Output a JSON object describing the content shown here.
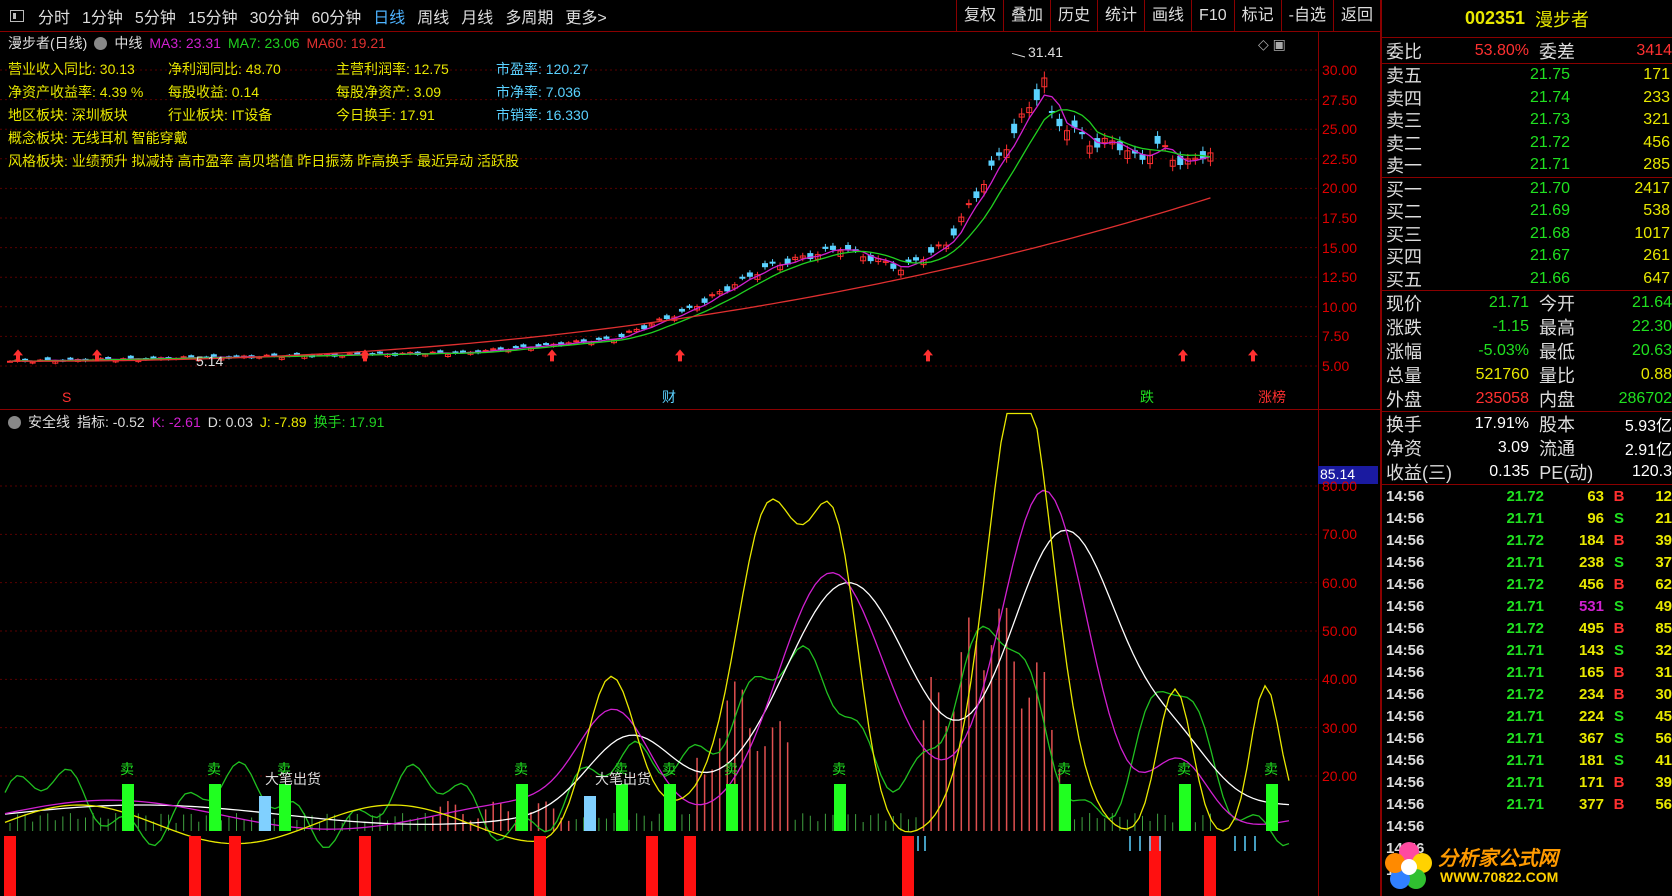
{
  "toolbar": {
    "periods": [
      "分时",
      "1分钟",
      "5分钟",
      "15分钟",
      "30分钟",
      "60分钟",
      "日线",
      "周线",
      "月线",
      "多周期",
      "更多>"
    ],
    "active_period": "日线",
    "tools": [
      "复权",
      "叠加",
      "历史",
      "统计",
      "画线",
      "F10",
      "标记",
      "-自选",
      "返回"
    ]
  },
  "main": {
    "stock_label": "漫步者(日线)",
    "mode": "中线",
    "ma3": "MA3: 23.31",
    "ma7": "MA7: 23.06",
    "ma60": "MA60: 19.21",
    "fund": [
      [
        {
          "k": "营业收入同比:",
          "v": "30.13"
        },
        {
          "k": "净利润同比:",
          "v": "48.70"
        },
        {
          "k": "主营利润率:",
          "v": "12.75"
        },
        {
          "k": "市盈率:",
          "v": "120.27",
          "cyan": true
        }
      ],
      [
        {
          "k": "净资产收益率:",
          "v": "4.39 %"
        },
        {
          "k": "每股收益:",
          "v": "0.14"
        },
        {
          "k": "每股净资产:",
          "v": "3.09"
        },
        {
          "k": "市净率:",
          "v": "7.036"
        }
      ],
      [
        {
          "k": "地区板块:",
          "v": "深圳板块"
        },
        {
          "k": "行业板块:",
          "v": "IT设备"
        },
        {
          "k": "今日换手:",
          "v": "17.91"
        },
        {
          "k": "市销率:",
          "v": "16.330"
        }
      ]
    ],
    "concept": "概念板块: 无线耳机 智能穿戴",
    "style": "风格板块: 业绩预升 拟减持 高市盈率 高贝塔值 昨日振荡 昨高换手 最近异动 活跃股",
    "high_label": "31.41",
    "low_label": "5.14",
    "y_ticks": [
      "30.00",
      "27.50",
      "25.00",
      "22.50",
      "20.00",
      "17.50",
      "15.00",
      "12.50",
      "10.00",
      "7.50",
      "5.00"
    ],
    "events": [
      "S",
      "财",
      "跌",
      "涨榜"
    ]
  },
  "indicator": {
    "name": "安全线",
    "zhibiao": "指标: -0.52",
    "k": "K: -2.61",
    "d": "D: 0.03",
    "j": "J: -7.89",
    "huanshou": "换手: 17.91",
    "cursor_value": "85.14",
    "y_ticks": [
      "80.00",
      "70.00",
      "60.00",
      "50.00",
      "40.00",
      "30.00",
      "20.00"
    ],
    "sell_label": "卖",
    "big_label": "大笔出货"
  },
  "right": {
    "code": "002351",
    "name": "漫步者",
    "weibi_label": "委比",
    "weibi": "53.80%",
    "weicha_label": "委差",
    "weicha": "3414",
    "asks": [
      {
        "l": "卖五",
        "p": "21.75",
        "q": "171"
      },
      {
        "l": "卖四",
        "p": "21.74",
        "q": "233"
      },
      {
        "l": "卖三",
        "p": "21.73",
        "q": "321"
      },
      {
        "l": "卖二",
        "p": "21.72",
        "q": "456"
      },
      {
        "l": "卖一",
        "p": "21.71",
        "q": "285"
      }
    ],
    "bids": [
      {
        "l": "买一",
        "p": "21.70",
        "q": "2417"
      },
      {
        "l": "买二",
        "p": "21.69",
        "q": "538"
      },
      {
        "l": "买三",
        "p": "21.68",
        "q": "1017"
      },
      {
        "l": "买四",
        "p": "21.67",
        "q": "261"
      },
      {
        "l": "买五",
        "p": "21.66",
        "q": "647"
      }
    ],
    "quote": [
      {
        "l1": "现价",
        "v1": "21.71",
        "l2": "今开",
        "v2": "21.64",
        "c2": "#20e020"
      },
      {
        "l1": "涨跌",
        "v1": "-1.15",
        "l2": "最高",
        "v2": "22.30",
        "c2": "#20e020"
      },
      {
        "l1": "涨幅",
        "v1": "-5.03%",
        "l2": "最低",
        "v2": "20.63",
        "c2": "#20e020"
      },
      {
        "l1": "总量",
        "v1": "521760",
        "l2": "量比",
        "v2": "0.88",
        "c1": "#e8e800",
        "c2": "#e8e800"
      },
      {
        "l1": "外盘",
        "v1": "235058",
        "l2": "内盘",
        "v2": "286702",
        "c1": "#ff3030",
        "c2": "#20e020"
      }
    ],
    "stats": [
      {
        "l1": "换手",
        "v1": "17.91%",
        "l2": "股本",
        "v2": "5.93亿"
      },
      {
        "l1": "净资",
        "v1": "3.09",
        "l2": "流通",
        "v2": "2.91亿"
      },
      {
        "l1": "收益(三)",
        "v1": "0.135",
        "l2": "PE(动)",
        "v2": "120.3"
      }
    ],
    "ticks": [
      {
        "t": "14:56",
        "p": "21.72",
        "q": "63",
        "s": "B",
        "n": "12"
      },
      {
        "t": "14:56",
        "p": "21.71",
        "q": "96",
        "s": "S",
        "n": "21"
      },
      {
        "t": "14:56",
        "p": "21.72",
        "q": "184",
        "s": "B",
        "n": "39"
      },
      {
        "t": "14:56",
        "p": "21.71",
        "q": "238",
        "s": "S",
        "n": "37"
      },
      {
        "t": "14:56",
        "p": "21.72",
        "q": "456",
        "s": "B",
        "n": "62"
      },
      {
        "t": "14:56",
        "p": "21.71",
        "q": "531",
        "s": "S",
        "n": "49"
      },
      {
        "t": "14:56",
        "p": "21.72",
        "q": "495",
        "s": "B",
        "n": "85"
      },
      {
        "t": "14:56",
        "p": "21.71",
        "q": "143",
        "s": "S",
        "n": "32"
      },
      {
        "t": "14:56",
        "p": "21.71",
        "q": "165",
        "s": "B",
        "n": "31"
      },
      {
        "t": "14:56",
        "p": "21.72",
        "q": "234",
        "s": "B",
        "n": "30"
      },
      {
        "t": "14:56",
        "p": "21.71",
        "q": "224",
        "s": "S",
        "n": "45"
      },
      {
        "t": "14:56",
        "p": "21.71",
        "q": "367",
        "s": "S",
        "n": "56"
      },
      {
        "t": "14:56",
        "p": "21.71",
        "q": "181",
        "s": "S",
        "n": "41"
      },
      {
        "t": "14:56",
        "p": "21.71",
        "q": "171",
        "s": "B",
        "n": "39"
      },
      {
        "t": "14:56",
        "p": "21.71",
        "q": "377",
        "s": "B",
        "n": "56"
      },
      {
        "t": "14:56",
        "p": "",
        "q": "",
        "s": "",
        "n": ""
      },
      {
        "t": "14:56",
        "p": "",
        "q": "",
        "s": "",
        "n": ""
      },
      {
        "t": "14:56",
        "p": "",
        "q": "",
        "s": "",
        "n": ""
      }
    ],
    "watermark1": "分析家公式网",
    "watermark2": "WWW.70822.COM"
  }
}
